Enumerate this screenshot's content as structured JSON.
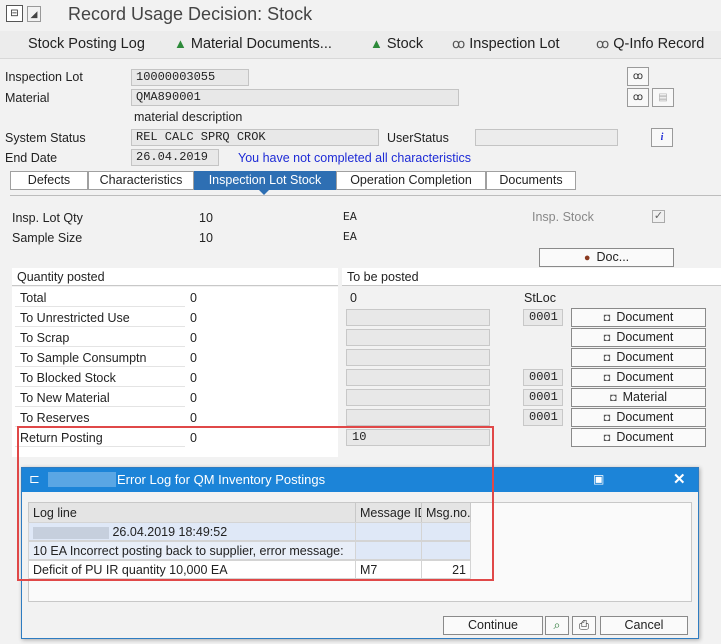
{
  "window": {
    "title": "Record Usage Decision: Stock"
  },
  "toolbar": {
    "stock_posting_log": "Stock Posting Log",
    "material_documents": "Material Documents...",
    "stock": "Stock",
    "inspection_lot": "Inspection Lot",
    "q_info_record": "Q-Info Record"
  },
  "header": {
    "inspection_lot_label": "Inspection Lot",
    "inspection_lot_value": "10000003055",
    "material_label": "Material",
    "material_value": "QMA890001",
    "material_description": "material description",
    "system_status_label": "System Status",
    "system_status_value": "REL  CALC SPRQ CROK",
    "user_status_label": "UserStatus",
    "user_status_value": "",
    "end_date_label": "End Date",
    "end_date_value": "26.04.2019",
    "info_message": "You have not completed all characteristics"
  },
  "tabs": [
    "Defects",
    "Characteristics",
    "Inspection Lot Stock",
    "Operation Completion",
    "Documents"
  ],
  "lot": {
    "insp_lot_qty_label": "Insp. Lot Qty",
    "insp_lot_qty_value": "10",
    "insp_lot_qty_unit": "EA",
    "sample_size_label": "Sample Size",
    "sample_size_value": "10",
    "sample_size_unit": "EA",
    "insp_stock_label": "Insp. Stock",
    "doc_button": "Doc..."
  },
  "postings": {
    "quantity_posted_header": "Quantity posted",
    "to_be_posted_header": "To be posted",
    "stloc_header": "StLoc",
    "rows": [
      {
        "label": "Total",
        "posted": "0",
        "to_be_posted": "0",
        "stloc": "",
        "button": ""
      },
      {
        "label": "To Unrestricted Use",
        "posted": "0",
        "to_be_posted": "",
        "stloc": "0001",
        "button": "Document"
      },
      {
        "label": "To Scrap",
        "posted": "0",
        "to_be_posted": "",
        "stloc": "",
        "button": "Document"
      },
      {
        "label": "To Sample Consumptn",
        "posted": "0",
        "to_be_posted": "",
        "stloc": "",
        "button": "Document"
      },
      {
        "label": "To Blocked Stock",
        "posted": "0",
        "to_be_posted": "",
        "stloc": "0001",
        "button": "Document"
      },
      {
        "label": "To New Material",
        "posted": "0",
        "to_be_posted": "",
        "stloc": "0001",
        "button": "Material"
      },
      {
        "label": "To Reserves",
        "posted": "0",
        "to_be_posted": "",
        "stloc": "0001",
        "button": "Document"
      },
      {
        "label": "Return Posting",
        "posted": "0",
        "to_be_posted": "10",
        "stloc": "",
        "button": "Document"
      }
    ]
  },
  "dialog": {
    "title": "Error Log for QM Inventory Postings",
    "columns": [
      "Log line",
      "Message ID",
      "Msg.no."
    ],
    "rows": [
      {
        "log_line": "26.04.2019 18:49:52",
        "message_id": "",
        "msg_no": ""
      },
      {
        "log_line": "10 EA Incorrect posting back to supplier, error message:",
        "message_id": "",
        "msg_no": ""
      },
      {
        "log_line": "Deficit of PU IR quantity 10,000 EA",
        "message_id": "M7",
        "msg_no": "21"
      }
    ],
    "continue_button": "Continue",
    "cancel_button": "Cancel"
  }
}
